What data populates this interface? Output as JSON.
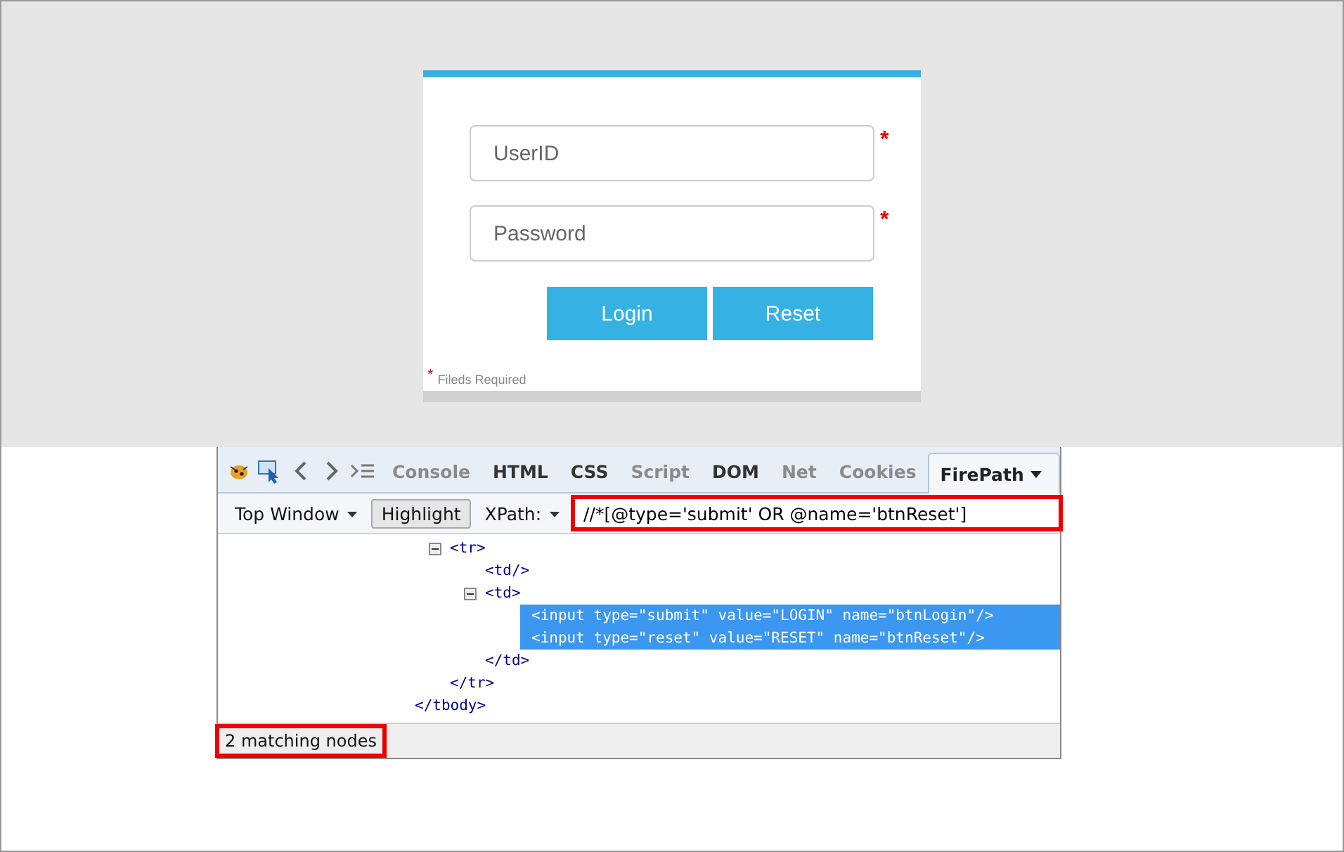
{
  "login_form": {
    "fields": [
      {
        "placeholder": "UserID",
        "required_mark": "*"
      },
      {
        "placeholder": "Password",
        "required_mark": "*"
      }
    ],
    "buttons": [
      "Login",
      "Reset"
    ],
    "note": {
      "mark": "*",
      "text": "Fileds Required"
    }
  },
  "devtools": {
    "tabs": [
      {
        "label": "Console",
        "selected": false,
        "disabled": true
      },
      {
        "label": "HTML",
        "selected": false,
        "disabled": false
      },
      {
        "label": "CSS",
        "selected": false,
        "disabled": false
      },
      {
        "label": "Script",
        "selected": false,
        "disabled": true
      },
      {
        "label": "DOM",
        "selected": false,
        "disabled": false
      },
      {
        "label": "Net",
        "selected": false,
        "disabled": true
      },
      {
        "label": "Cookies",
        "selected": false,
        "disabled": true
      },
      {
        "label": "FirePath",
        "selected": true,
        "disabled": false
      }
    ],
    "toolbar": {
      "window_menu": "Top Window",
      "highlight": {
        "label": "Highlight",
        "on": true
      },
      "mode_menu": "XPath:",
      "xpath": {
        "value": "//*[@type='submit' OR @name='btnReset']",
        "highlighted": true
      }
    },
    "tree": [
      {
        "close": "</tbody>",
        "children": [
          {
            "open": "<tr>",
            "expanded": true,
            "close": "</tr>",
            "children": [
              {
                "open": "<td/>"
              },
              {
                "open": "<td>",
                "expanded": true,
                "close": "</td>",
                "children": [
                  {
                    "open": "<input type=\"submit\" value=\"LOGIN\" name=\"btnLogin\"/>",
                    "selected": true
                  },
                  {
                    "open": "<input type=\"reset\" value=\"RESET\" name=\"btnReset\"/>",
                    "selected": true
                  }
                ]
              }
            ]
          }
        ]
      }
    ],
    "status": {
      "text": "2 matching nodes",
      "highlighted": true
    }
  }
}
